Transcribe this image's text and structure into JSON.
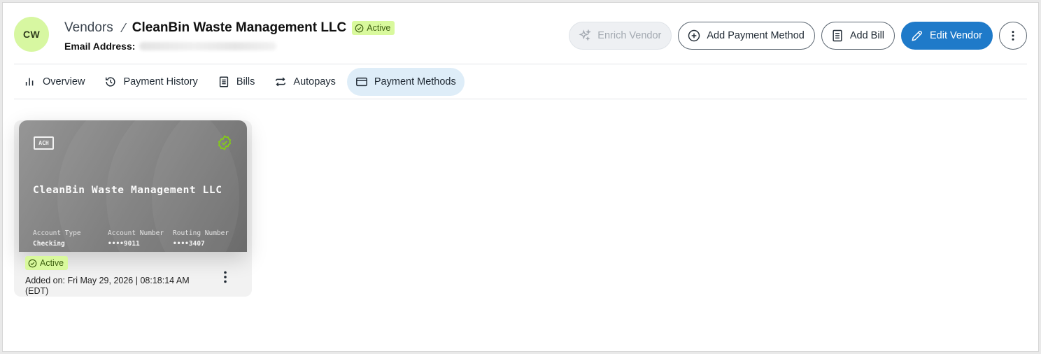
{
  "header": {
    "avatar_initials": "CW",
    "breadcrumb_parent": "Vendors",
    "breadcrumb_current": "CleanBin Waste Management LLC",
    "status": "Active",
    "email_label": "Email Address:"
  },
  "actions": {
    "enrich": "Enrich Vendor",
    "add_payment_method": "Add Payment Method",
    "add_bill": "Add Bill",
    "edit_vendor": "Edit Vendor"
  },
  "tabs": [
    {
      "label": "Overview",
      "icon": "bar-chart-icon"
    },
    {
      "label": "Payment History",
      "icon": "history-icon"
    },
    {
      "label": "Bills",
      "icon": "document-icon"
    },
    {
      "label": "Autopays",
      "icon": "repeat-icon"
    },
    {
      "label": "Payment Methods",
      "icon": "credit-card-icon",
      "active": true
    }
  ],
  "payment_method": {
    "type_badge": "ACH",
    "name": "CleanBin Waste Management LLC",
    "account_type_label": "Account Type",
    "account_type": "Checking",
    "account_number_label": "Account Number",
    "account_number": "••••9011",
    "routing_number_label": "Routing Number",
    "routing_number": "••••3407",
    "status": "Active",
    "added_on": "Added on: Fri May 29, 2026 | 08:18:14 AM (EDT)"
  },
  "colors": {
    "primary": "#1f7ac9",
    "active_badge_bg": "#d9f99d",
    "avatar_bg": "#d7f7a1",
    "active_tab_bg": "#deedf8",
    "verified_green": "#84cc16"
  }
}
